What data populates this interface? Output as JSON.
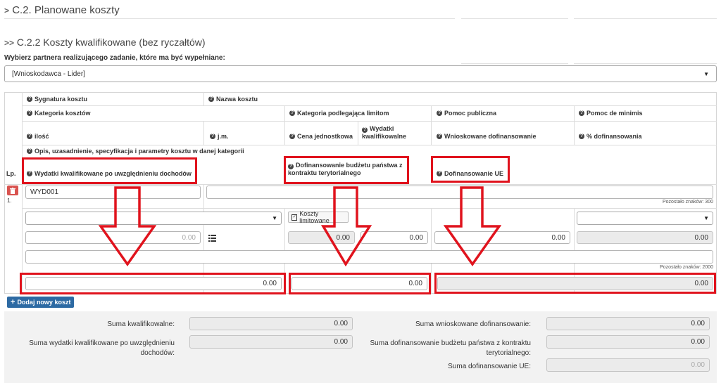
{
  "section": {
    "c2_title": "C.2. Planowane koszty",
    "c22_title": "C.2.2 Koszty kwalifikowane (bez ryczałtów)"
  },
  "partner": {
    "label": "Wybierz partnera realizującego zadanie, które ma być wypełniane:",
    "selected": "[Wnioskodawca - Lider]"
  },
  "table": {
    "lp_header": "Lp.",
    "headers": {
      "sygnatura": "Sygnatura kosztu",
      "nazwa": "Nazwa kosztu",
      "kategoria": "Kategoria kosztów",
      "kategoria_limit": "Kategoria podlegająca limitom",
      "pomoc_publiczna": "Pomoc publiczna",
      "pomoc_de_minimis": "Pomoc de minimis",
      "ilosc": "ilość",
      "jm": "j.m.",
      "cena": "Cena jednostkowa",
      "wydatki_kw_1": "Wydatki",
      "wydatki_kw_2": "kwalifikowalne",
      "wnioskowane": "Wnioskowane dofinansowanie",
      "procent": "% dofinansowania",
      "opis": "Opis, uzasadnienie, specyfikacja i parametry kosztu w danej kategorii",
      "wydatki_po_doch": "Wydatki kwalifikowane po uwzględnieniu dochodów",
      "budzet_1": "Dofinansowanie budżetu państwa z",
      "budzet_2": "kontraktu terytorialnego",
      "ue": "Dofinansowanie UE"
    },
    "row": {
      "number": "1.",
      "sygnatura": "WYD001",
      "remaining_name": "Pozostało znaków: 300",
      "koszty_button": "Koszty limitowane",
      "ilosc": "0.00",
      "cena": "0.00",
      "wydatki": "0.00",
      "wnioskowane": "0.00",
      "procent": "0.00",
      "remaining_opis": "Pozostało znaków: 2000",
      "wydatki_po_doch": "0.00",
      "budzet": "0.00",
      "ue": "0.00"
    }
  },
  "add_button": "Dodaj nowy koszt",
  "sums": {
    "kwalifikowalne_label": "Suma kwalifikowalne:",
    "kwalifikowalne": "0.00",
    "po_doch_label_1": "Suma wydatki kwalifikowane po uwzględnieniu",
    "po_doch_label_2": "dochodów:",
    "po_doch": "0.00",
    "wnioskowane_label": "Suma wnioskowane dofinansowanie:",
    "wnioskowane": "0.00",
    "budzet_label_1": "Suma dofinansowanie budżetu państwa z kontraktu",
    "budzet_label_2": "terytorialnego:",
    "budzet": "0.00",
    "ue_label": "Suma dofinansowanie UE:",
    "ue": "0.00"
  },
  "colors": {
    "highlight": "#e0131d",
    "button": "#2d6aa3",
    "delete": "#d9534f"
  }
}
